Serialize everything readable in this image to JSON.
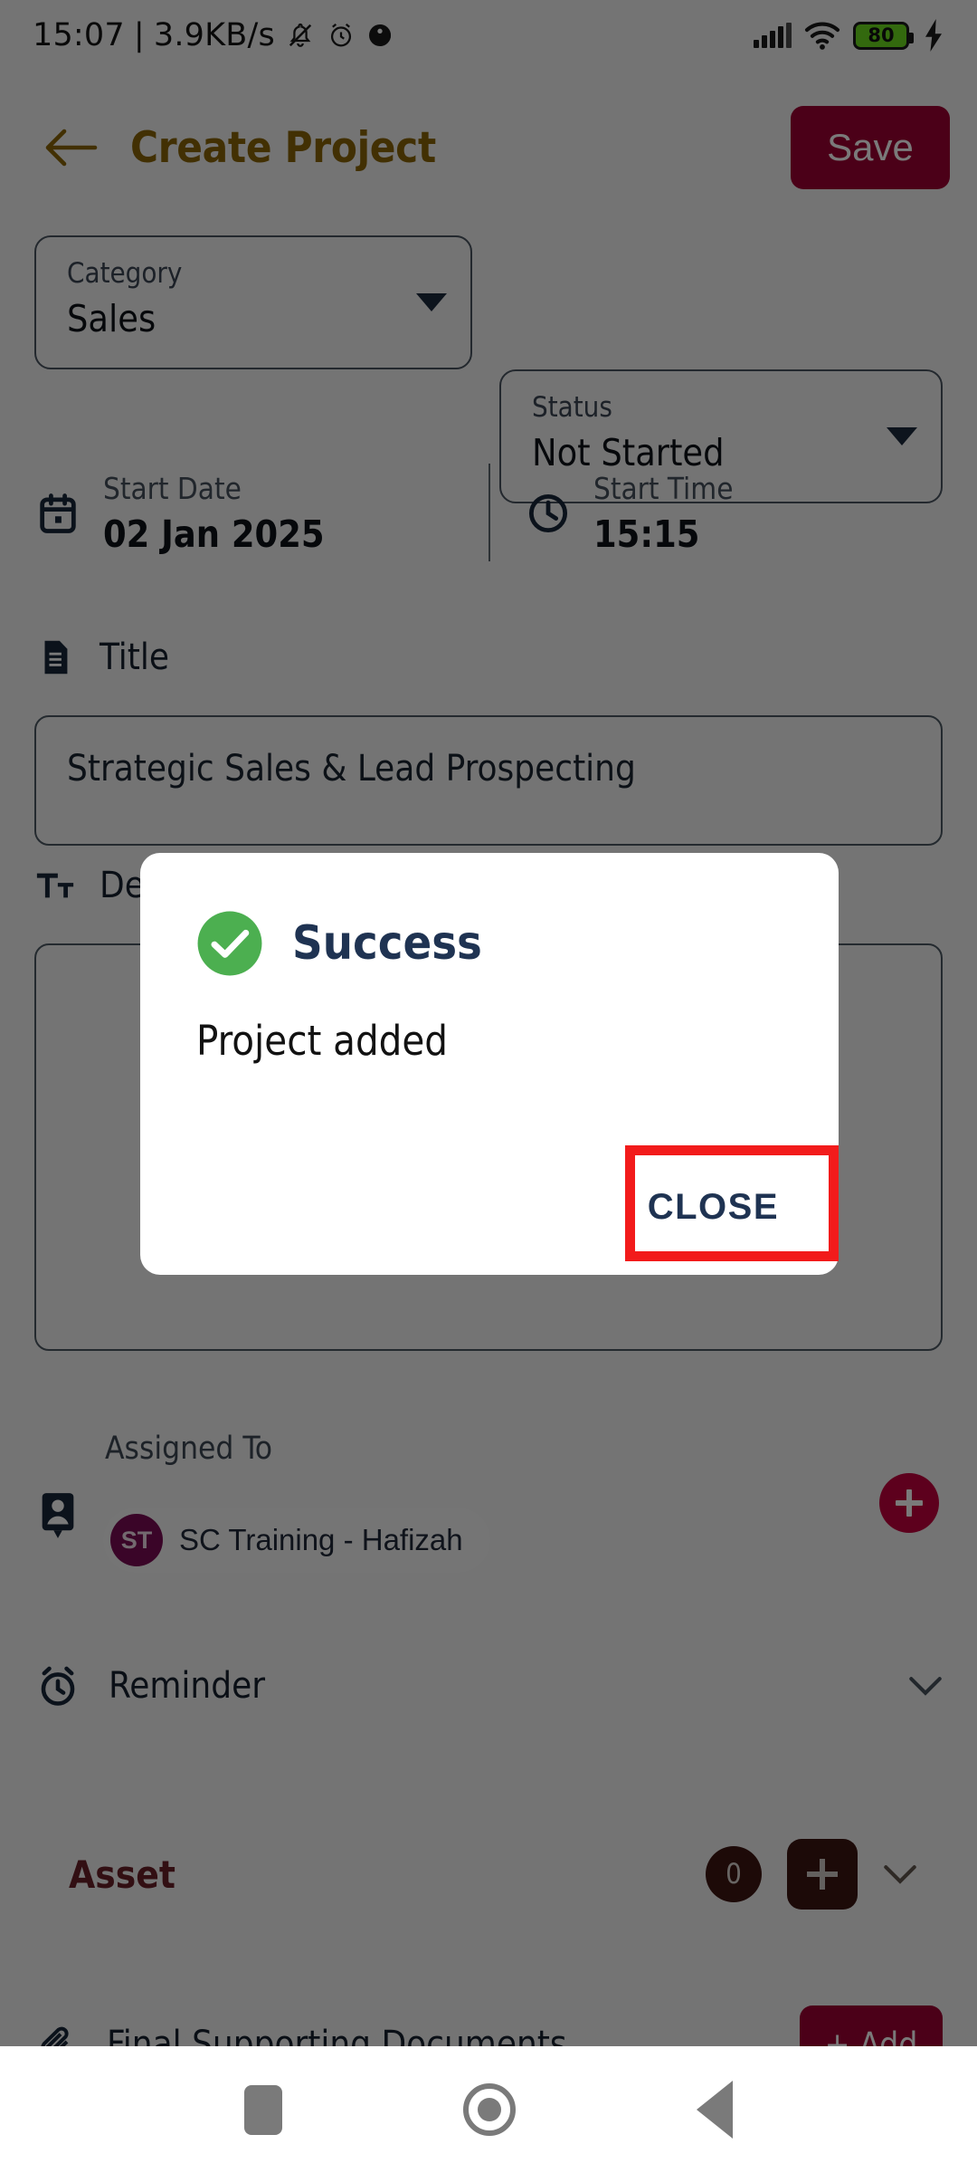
{
  "status_bar": {
    "time": "15:07",
    "separator": "|",
    "network_speed": "3.9KB/s",
    "icons": [
      "notifications-silenced-icon",
      "alarm-icon",
      "dnd-icon",
      "signal-bars-icon",
      "wifi-icon",
      "battery-icon",
      "charging-bolt-icon"
    ],
    "battery_level": "80"
  },
  "header": {
    "back_icon": "back-arrow-icon",
    "title": "Create Project",
    "title_color": "#8a6508",
    "save_label": "Save",
    "save_color": "#9E0032"
  },
  "form": {
    "category": {
      "label": "Category",
      "value": "Sales"
    },
    "status": {
      "label": "Status",
      "value": "Not Started"
    },
    "start_date": {
      "label": "Start Date",
      "value": "02 Jan 2025",
      "icon": "calendar-icon"
    },
    "start_time": {
      "label": "Start Time",
      "value": "15:15",
      "icon": "clock-icon"
    },
    "title_field": {
      "label": "Title",
      "icon": "document-icon",
      "value": "Strategic Sales & Lead Prospecting"
    },
    "description_field": {
      "label": "Description",
      "icon": "text-format-icon",
      "value": ""
    },
    "assigned_to": {
      "label": "Assigned To",
      "icon": "contact-card-icon",
      "add_button_icon": "plus-icon",
      "chips": [
        {
          "initials": "ST",
          "name": "SC Training - Hafizah",
          "avatar_color": "#7A0B54"
        }
      ]
    },
    "reminder": {
      "label": "Reminder",
      "icon": "alarm-clock-icon",
      "chevron": "chevron-down-icon"
    },
    "asset": {
      "label": "Asset",
      "count": "0",
      "add_button_icon": "plus-icon",
      "chevron": "chevron-down-icon"
    },
    "final_documents": {
      "label": "Final Supporting Documents",
      "icon": "paperclip-icon",
      "add_label": "+ Add"
    }
  },
  "dialog": {
    "icon": "success-check-icon",
    "icon_color": "#4CAF50",
    "title": "Success",
    "message": "Project added",
    "close_label": "CLOSE",
    "title_color": "#1F3352",
    "highlight_color": "#F21B1B"
  },
  "nav_bar": {
    "recents_icon": "square-recents-icon",
    "home_icon": "circle-home-icon",
    "back_icon": "triangle-back-icon"
  }
}
